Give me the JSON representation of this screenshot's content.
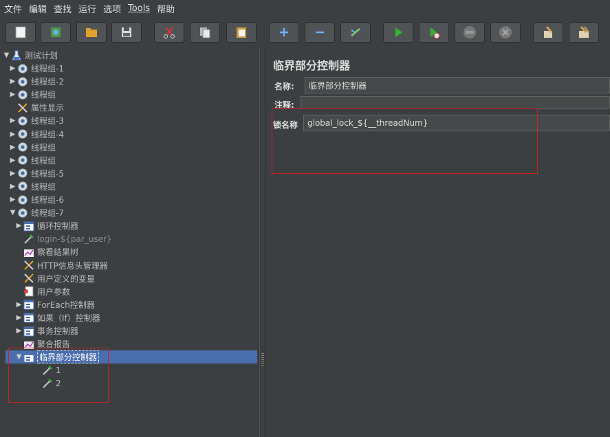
{
  "menubar": {
    "items": [
      {
        "label": "文件"
      },
      {
        "label": "编辑"
      },
      {
        "label": "查找"
      },
      {
        "label": "运行"
      },
      {
        "label": "选项"
      },
      {
        "label": "Tools"
      },
      {
        "label": "帮助"
      }
    ]
  },
  "toolbar": {
    "buttons": [
      {
        "name": "new-icon"
      },
      {
        "name": "templates-icon"
      },
      {
        "name": "open-icon"
      },
      {
        "name": "save-icon"
      },
      {
        "name": "cut-icon"
      },
      {
        "name": "copy-icon"
      },
      {
        "name": "paste-icon"
      },
      {
        "name": "expand-icon"
      },
      {
        "name": "collapse-icon"
      },
      {
        "name": "toggle-icon"
      },
      {
        "name": "start-icon"
      },
      {
        "name": "start-no-pause-icon"
      },
      {
        "name": "stop-icon"
      },
      {
        "name": "shutdown-icon"
      },
      {
        "name": "clear-icon"
      },
      {
        "name": "clear-all-icon"
      }
    ]
  },
  "tree": {
    "root": "测试计划",
    "nodes": [
      {
        "label": "线程组-1"
      },
      {
        "label": "线程组-2"
      },
      {
        "label": "线程组"
      },
      {
        "label": "属性显示"
      },
      {
        "label": "线程组-3"
      },
      {
        "label": "线程组-4"
      },
      {
        "label": "线程组"
      },
      {
        "label": "线程组"
      },
      {
        "label": "线程组-5"
      },
      {
        "label": "线程组"
      },
      {
        "label": "线程组-6"
      },
      {
        "label": "线程组-7"
      },
      {
        "label": "循环控制器"
      },
      {
        "label": "login-${par_user}"
      },
      {
        "label": "察看结果树"
      },
      {
        "label": "HTTP信息头管理器"
      },
      {
        "label": "用户定义的变量"
      },
      {
        "label": "用户参数"
      },
      {
        "label": "ForEach控制器"
      },
      {
        "label": "如果（If）控制器"
      },
      {
        "label": "事务控制器"
      },
      {
        "label": "聚合报告"
      },
      {
        "label": "临界部分控制器"
      },
      {
        "label": "1"
      },
      {
        "label": "2"
      }
    ]
  },
  "editor": {
    "title": "临界部分控制器",
    "name_label": "名称:",
    "name_value": "临界部分控制器",
    "comment_label": "注释:",
    "comment_value": "",
    "lock_label": "锁名称",
    "lock_value": "global_lock_${__threadNum}"
  },
  "colors": {
    "background": "#3c3f41",
    "selection": "#4b6eaf",
    "highlight_box": "#cc2222"
  }
}
